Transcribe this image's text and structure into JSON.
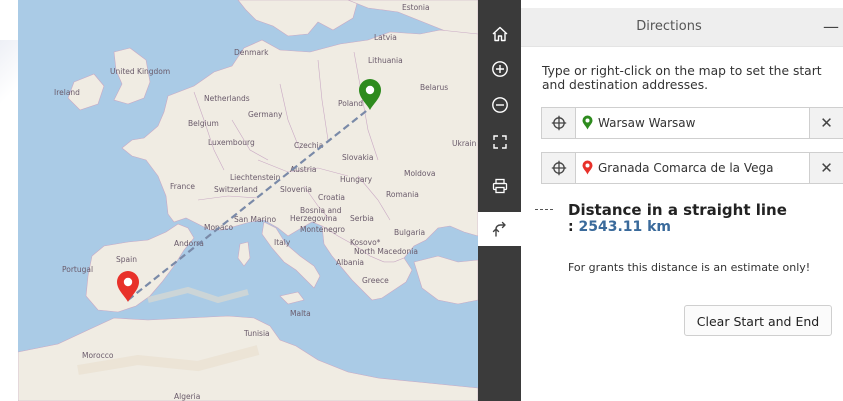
{
  "toolbar": {
    "buttons": [
      {
        "name": "home-icon"
      },
      {
        "name": "zoom-in-icon"
      },
      {
        "name": "zoom-out-icon"
      },
      {
        "name": "fullscreen-icon"
      },
      {
        "name": "print-icon"
      },
      {
        "name": "directions-icon",
        "active": true
      }
    ]
  },
  "panel": {
    "title": "Directions",
    "minimize": "—",
    "instructions": "Type or right-click on the map to set the start and destination addresses.",
    "start": {
      "value": "Warsaw  Warsaw",
      "pin_color": "#2e8b1e"
    },
    "destination": {
      "value": "Granada  Comarca de la Vega c",
      "pin_color": "#e8312a"
    },
    "clear_symbol": "✕",
    "distance_title": "Distance in a straight line",
    "distance_prefix": ":",
    "distance_value": "2543.11 km",
    "note": "For grants this distance is an estimate only!",
    "clear_button": "Clear Start and End"
  },
  "map": {
    "labels": {
      "estonia": "Estonia",
      "latvia": "Latvia",
      "denmark": "Denmark",
      "lithuania": "Lithuania",
      "united_kingdom": "United Kingdom",
      "ireland": "Ireland",
      "belarus": "Belarus",
      "netherlands": "Netherlands",
      "poland": "Poland",
      "germany": "Germany",
      "belgium": "Belgium",
      "luxembourg": "Luxembourg",
      "czechia": "Czechia",
      "ukraine": "Ukrain",
      "slovakia": "Slovakia",
      "austria": "Austria",
      "moldova": "Moldova",
      "liechtenstein": "Liechtenstein",
      "hungary": "Hungary",
      "france": "France",
      "switzerland": "Switzerland",
      "slovenia": "Slovenia",
      "croatia": "Croatia",
      "romania": "Romania",
      "bosnia1": "Bosnia and",
      "bosnia2": "Herzegovina",
      "serbia": "Serbia",
      "san_marino": "San Marino",
      "monaco": "Monaco",
      "montenegro": "Montenegro",
      "bulgaria": "Bulgaria",
      "andorra": "Andorra",
      "italy": "Italy",
      "kosovo": "Kosovo*",
      "north_macedonia": "North Macedonia",
      "spain": "Spain",
      "albania": "Albania",
      "portugal": "Portugal",
      "greece": "Greece",
      "malta": "Malta",
      "tunisia": "Tunisia",
      "morocco": "Morocco",
      "algeria": "Algeria"
    },
    "route_line_color": "#7a8aa8",
    "start_marker_color": "#2e8b1e",
    "end_marker_color": "#e8312a"
  }
}
